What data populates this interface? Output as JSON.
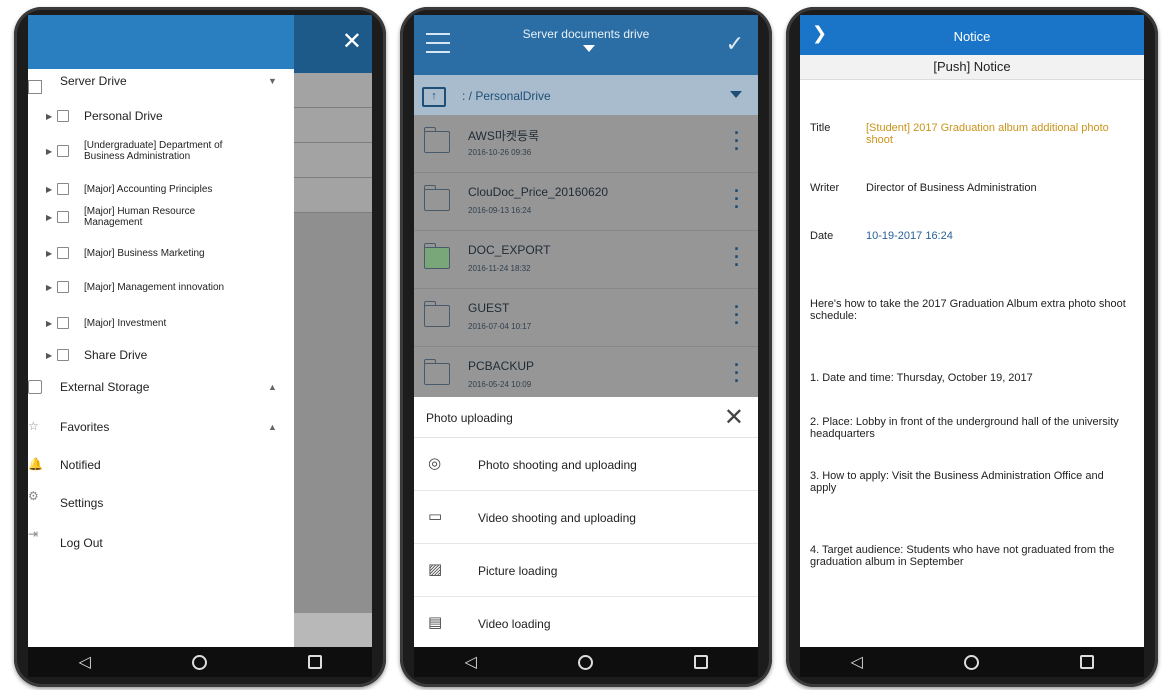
{
  "phone1": {
    "drawer": {
      "items": [
        {
          "label": "Server Drive"
        },
        {
          "label": "Personal Drive"
        },
        {
          "label": "[Undergraduate] Department of Business Administration"
        },
        {
          "label": "[Major] Accounting Principles"
        },
        {
          "label": "[Major] Human Resource Management"
        },
        {
          "label": "[Major] Business Marketing"
        },
        {
          "label": "[Major] Management innovation"
        },
        {
          "label": "[Major] Investment"
        },
        {
          "label": "Share Drive"
        },
        {
          "label": "External Storage"
        },
        {
          "label": "Favorites"
        },
        {
          "label": "Notified"
        },
        {
          "label": "Settings"
        },
        {
          "label": "Log Out"
        }
      ]
    }
  },
  "phone2": {
    "header": {
      "title": "Server documents drive"
    },
    "path": ": / PersonalDrive",
    "files": [
      {
        "name": "AWS마켓등록",
        "date": "2016-10-26 09:36"
      },
      {
        "name": "ClouDoc_Price_20160620",
        "date": "2016-09-13 16:24"
      },
      {
        "name": "DOC_EXPORT",
        "date": "2016-11-24 18:32"
      },
      {
        "name": "GUEST",
        "date": "2016-07-04 10:17"
      },
      {
        "name": "PCBACKUP",
        "date": "2016-05-24 10:09"
      }
    ],
    "sheet": {
      "title": "Photo uploading",
      "options": [
        "Photo shooting and uploading",
        "Video shooting and uploading",
        "Picture loading",
        "Video loading"
      ]
    }
  },
  "phone3": {
    "header": {
      "title": "Notice"
    },
    "subheader": "[Push] Notice",
    "meta": {
      "title_label": "Title",
      "title_value": "[Student] 2017 Graduation album additional photo shoot",
      "writer_label": "Writer",
      "writer_value": "Director of Business Administration",
      "date_label": "Date",
      "date_value": "10-19-2017 16:24"
    },
    "paragraphs": [
      "Here's how to take the 2017 Graduation Album extra photo shoot schedule:",
      "1.    Date and time: Thursday, October 19, 2017",
      "2. Place: Lobby in front of the underground hall of the university headquarters",
      "3. How to apply: Visit the Business Administration Office and apply",
      "4. Target audience: Students who have not graduated from the graduation album in September"
    ]
  },
  "colors": {
    "drawer_header": "#2a7fc1",
    "p2_header": "#2a6ea5",
    "p3_header": "#1a74c7",
    "title_accent": "#c8941a",
    "date_accent": "#2a5f97"
  }
}
